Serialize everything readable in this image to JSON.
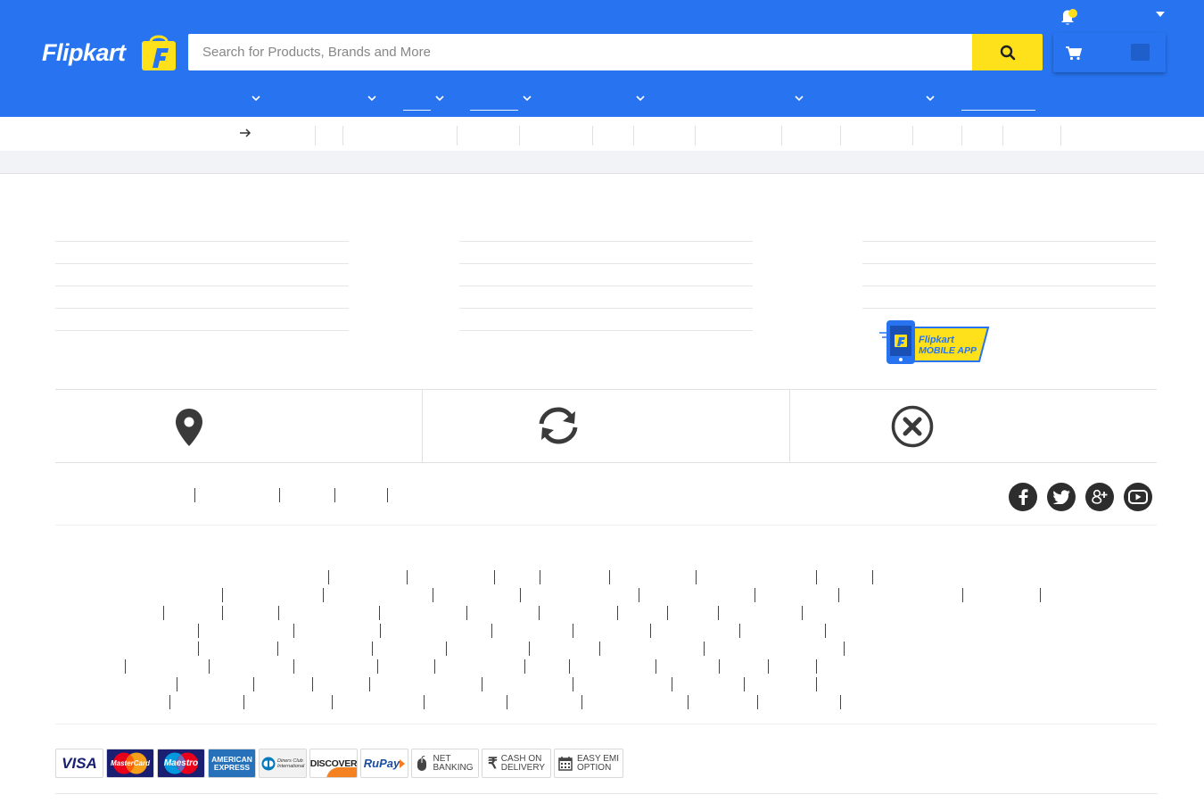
{
  "brand": {
    "name": "Flipkart",
    "color": "#2874f0",
    "accent": "#ffe11b"
  },
  "search": {
    "placeholder": "Search for Products, Brands and More",
    "value": ""
  },
  "header": {
    "icons": [
      "bell-icon",
      "search-icon",
      "cart-icon",
      "chevron-down-icon"
    ]
  },
  "mobile_app": {
    "line1": "Flipkart",
    "line2": "MOBILE APP"
  },
  "features": {
    "icons": [
      "map-pin-icon",
      "refresh-icon",
      "cancel-circle-icon"
    ]
  },
  "social": {
    "icons": [
      "facebook-icon",
      "twitter-icon",
      "google-plus-icon",
      "youtube-icon"
    ]
  },
  "payments": [
    {
      "id": "visa",
      "label": "VISA"
    },
    {
      "id": "mastercard",
      "label": "MasterCard"
    },
    {
      "id": "maestro",
      "label": "Maestro"
    },
    {
      "id": "amex",
      "label": "AMERICAN EXPRESS"
    },
    {
      "id": "diners",
      "label": "Diners Club International"
    },
    {
      "id": "discover",
      "label": "DISCOVER"
    },
    {
      "id": "rupay",
      "label": "RuPay"
    },
    {
      "id": "net-banking",
      "label_line1": "NET",
      "label_line2": "BANKING"
    },
    {
      "id": "cod",
      "label_line1": "CASH ON",
      "label_line2": "DELIVERY"
    },
    {
      "id": "emi",
      "label_line1": "EASY EMI",
      "label_line2": "OPTION"
    }
  ]
}
